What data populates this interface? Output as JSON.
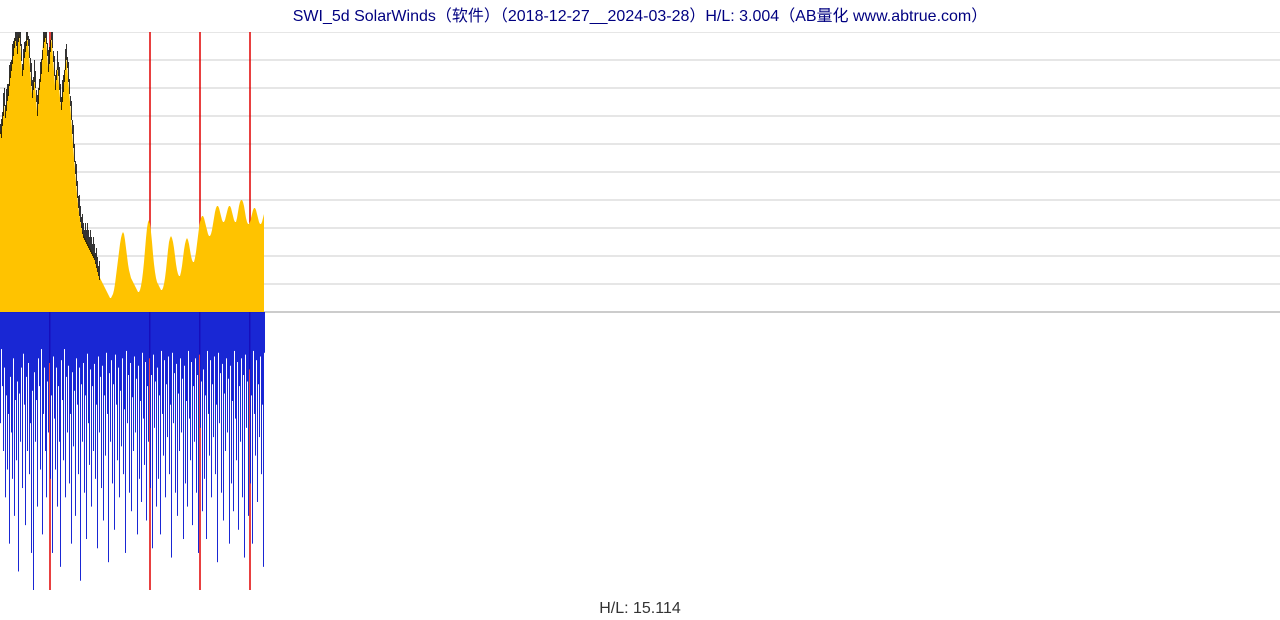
{
  "title": "SWI_5d SolarWinds（软件）（2018-12-27__2024-03-28）H/L: 3.004（AB量化  www.abtrue.com）",
  "footer": "H/L: 15.114",
  "chart_data": {
    "type": "area",
    "title": "SWI_5d SolarWinds（软件）（2018-12-27__2024-03-28）H/L: 3.004",
    "xlabel": "",
    "ylabel": "",
    "xlim": [
      0,
      265
    ],
    "ylim_upper": [
      0,
      280
    ],
    "ylim_lower": [
      0,
      300
    ],
    "grid": {
      "upper_horizontal_lines": 10,
      "vertical_red_lines_at": [
        50,
        150,
        200,
        250
      ]
    },
    "note": "Upper panel is a yellow-filled price/area series with black candlestick wicks; lower panel is a mirrored blue volume histogram. Only ~265 of the full width contains data; remainder is blank grid. Values below are visual estimates (pixel heights normalized to panel max).",
    "series": [
      {
        "name": "price_area_yellow",
        "panel": "upper",
        "color": "#FFC300",
        "values": [
          182,
          178,
          190,
          200,
          210,
          198,
          205,
          215,
          220,
          230,
          238,
          245,
          252,
          260,
          268,
          275,
          270,
          262,
          274,
          278,
          270,
          255,
          240,
          246,
          258,
          264,
          270,
          276,
          270,
          258,
          244,
          230,
          218,
          226,
          234,
          228,
          214,
          200,
          212,
          226,
          234,
          242,
          256,
          268,
          274,
          278,
          272,
          260,
          244,
          252,
          264,
          276,
          268,
          254,
          240,
          226,
          236,
          246,
          240,
          226,
          214,
          206,
          214,
          224,
          234,
          246,
          256,
          248,
          234,
          222,
          210,
          196,
          182,
          168,
          154,
          142,
          130,
          118,
          108,
          100,
          94,
          88,
          82,
          78,
          76,
          74,
          72,
          70,
          68,
          66,
          64,
          62,
          60,
          58,
          56,
          52,
          48,
          44,
          40,
          36,
          34,
          32,
          30,
          28,
          26,
          24,
          22,
          20,
          18,
          16,
          14,
          14,
          16,
          18,
          22,
          28,
          36,
          44,
          52,
          60,
          68,
          74,
          78,
          80,
          78,
          72,
          64,
          56,
          48,
          42,
          38,
          34,
          32,
          30,
          28,
          26,
          24,
          22,
          20,
          20,
          22,
          26,
          32,
          40,
          50,
          62,
          74,
          84,
          90,
          92,
          88,
          80,
          70,
          58,
          48,
          40,
          34,
          30,
          28,
          26,
          24,
          22,
          22,
          24,
          28,
          34,
          42,
          52,
          62,
          70,
          74,
          76,
          74,
          70,
          64,
          56,
          48,
          42,
          38,
          36,
          36,
          40,
          46,
          54,
          62,
          68,
          72,
          74,
          72,
          68,
          62,
          56,
          52,
          50,
          50,
          54,
          60,
          68,
          76,
          84,
          90,
          94,
          96,
          96,
          94,
          90,
          86,
          82,
          78,
          76,
          76,
          78,
          82,
          88,
          94,
          100,
          104,
          106,
          106,
          104,
          100,
          96,
          92,
          90,
          90,
          92,
          96,
          100,
          104,
          106,
          106,
          104,
          100,
          96,
          92,
          90,
          90,
          94,
          100,
          106,
          110,
          112,
          112,
          110,
          106,
          100,
          94,
          90,
          88,
          88,
          90,
          94,
          98,
          102,
          104,
          104,
          102,
          98,
          94,
          90,
          88,
          88,
          90,
          94,
          98
        ]
      },
      {
        "name": "wick_black",
        "panel": "upper",
        "color": "#000000",
        "note": "High-low wicks drawn above the yellow fill at many bars in the first ~100 columns; amplitude roughly 8–20 units above the yellow value.",
        "values": []
      },
      {
        "name": "volume_blue",
        "panel": "lower",
        "color": "#0010D0",
        "values": [
          120,
          40,
          80,
          150,
          60,
          200,
          90,
          170,
          110,
          250,
          70,
          130,
          180,
          50,
          220,
          95,
          160,
          75,
          280,
          88,
          140,
          60,
          190,
          45,
          100,
          230,
          70,
          150,
          55,
          175,
          120,
          260,
          85,
          300,
          65,
          140,
          95,
          210,
          50,
          80,
          170,
          40,
          240,
          110,
          60,
          150,
          200,
          75,
          130,
          55,
          180,
          90,
          260,
          48,
          115,
          170,
          60,
          210,
          80,
          140,
          275,
          52,
          95,
          160,
          40,
          200,
          70,
          130,
          58,
          185,
          110,
          250,
          65,
          145,
          85,
          220,
          50,
          100,
          175,
          60,
          290,
          78,
          140,
          55,
          195,
          90,
          245,
          45,
          120,
          165,
          62,
          210,
          80,
          150,
          56,
          180,
          100,
          255,
          48,
          130,
          70,
          190,
          58,
          225,
          90,
          155,
          44,
          110,
          270,
          66,
          140,
          52,
          185,
          78,
          235,
          46,
          100,
          160,
          60,
          200,
          85,
          145,
          50,
          175,
          105,
          260,
          42,
          120,
          68,
          195,
          55,
          215,
          92,
          150,
          48,
          130,
          72,
          240,
          58,
          180,
          96,
          205,
          44,
          115,
          165,
          54,
          225,
          80,
          140,
          50,
          190,
          68,
          255,
          46,
          125,
          75,
          210,
          60,
          180,
          90,
          240,
          42,
          110,
          155,
          52,
          200,
          78,
          135,
          48,
          175,
          100,
          265,
          44,
          120,
          66,
          195,
          56,
          220,
          88,
          150,
          50,
          130,
          72,
          245,
          58,
          185,
          96,
          210,
          42,
          115,
          160,
          54,
          230,
          80,
          140,
          50,
          195,
          68,
          260,
          46,
          125,
          75,
          215,
          62,
          180,
          90,
          245,
          42,
          110,
          155,
          52,
          200,
          78,
          135,
          48,
          175,
          100,
          270,
          44,
          120,
          66,
          195,
          56,
          225,
          88,
          150,
          50,
          130,
          72,
          250,
          58,
          185,
          96,
          215,
          42,
          115,
          160,
          54,
          235,
          80,
          140,
          50,
          200,
          68,
          265,
          46,
          125,
          75,
          220,
          62,
          185,
          90,
          250,
          42,
          110,
          155,
          52,
          205,
          78,
          135,
          48,
          175,
          100,
          275,
          44
        ]
      }
    ]
  }
}
